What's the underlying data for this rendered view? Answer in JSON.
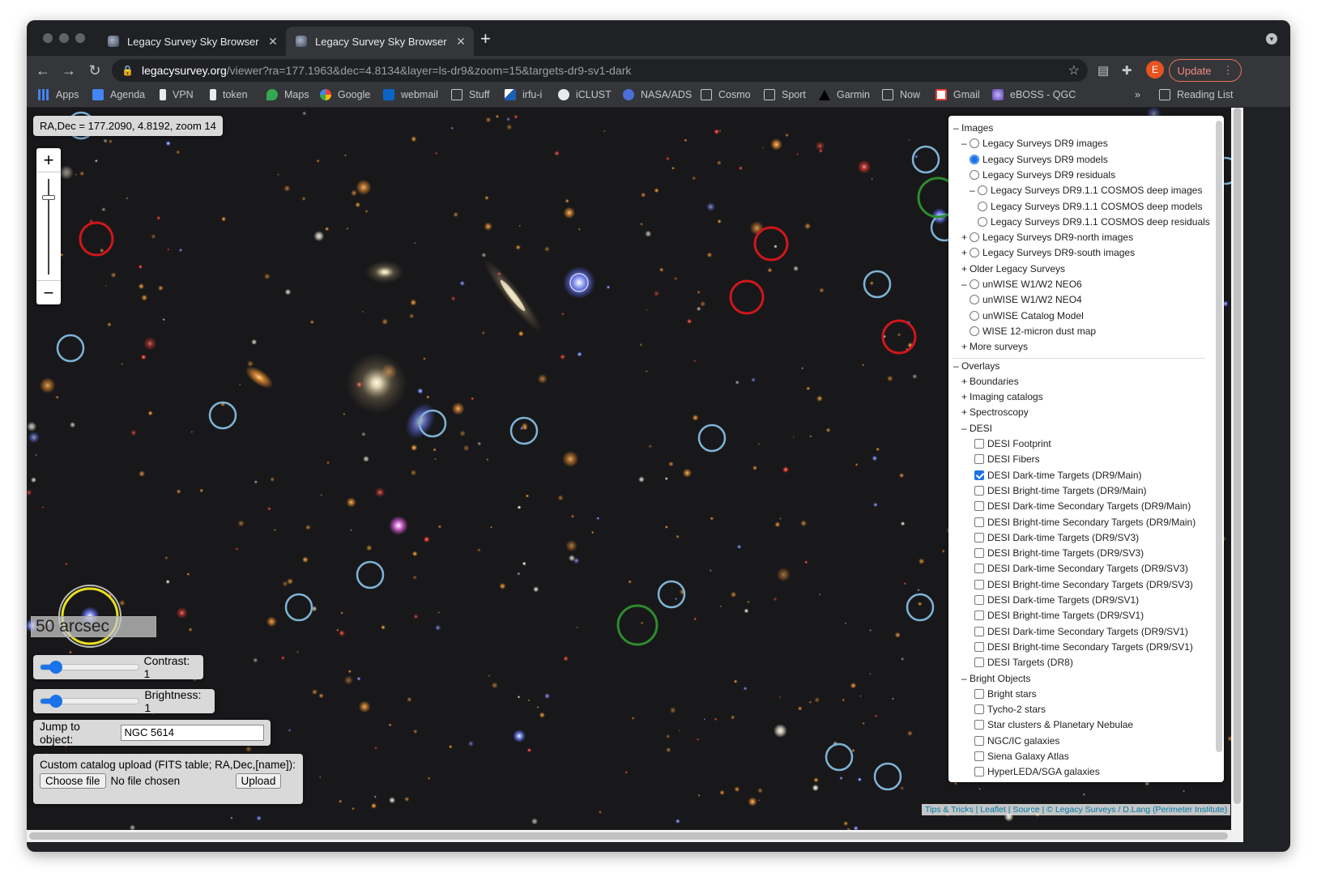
{
  "browser": {
    "tabs": [
      {
        "title": "Legacy Survey Sky Browser",
        "active": false
      },
      {
        "title": "Legacy Survey Sky Browser",
        "active": true
      }
    ],
    "url_host": "legacysurvey.org",
    "url_path": "/viewer?ra=177.1963&dec=4.8134&layer=ls-dr9&zoom=15&targets-dr9-sv1-dark",
    "profile_initial": "E",
    "update_label": "Update",
    "bookmarks": [
      "Apps",
      "Agenda",
      "VPN",
      "token",
      "Maps",
      "Google",
      "webmail",
      "Stuff",
      "irfu-i",
      "iCLUST",
      "NASA/ADS",
      "Cosmo",
      "Sport",
      "Garmin",
      "Now",
      "Gmail",
      "eBOSS - QGC"
    ],
    "more_bookmarks": "»",
    "reading_list": "Reading List"
  },
  "viewer": {
    "coords_text": "RA,Dec = 177.2090, 4.8192, zoom 14",
    "zoom_in": "+",
    "zoom_out": "−",
    "scale_label": "50 arcsec",
    "contrast_label": "Contrast: 1",
    "contrast_value": 0.15,
    "brightness_label": "Brightness: 1",
    "brightness_value": 0.15,
    "jump_label": "Jump to object:",
    "jump_value": "NGC 5614",
    "upload_label": "Custom catalog upload (FITS table; RA,Dec,[name]):",
    "choose_file": "Choose file",
    "no_file": "No file chosen",
    "upload_button": "Upload",
    "attribution": "Tips & Tricks | Leaflet | Source | © Legacy Surveys / D.Lang (Perimeter Institute)"
  },
  "layers": {
    "images_header": "– Images",
    "images": [
      {
        "prefix": "–",
        "label": "Legacy Surveys DR9 images",
        "type": "radio",
        "checked": false,
        "indent": 1
      },
      {
        "prefix": "",
        "label": "Legacy Surveys DR9 models",
        "type": "radio",
        "checked": true,
        "indent": 1
      },
      {
        "prefix": "",
        "label": "Legacy Surveys DR9 residuals",
        "type": "radio",
        "checked": false,
        "indent": 1
      },
      {
        "prefix": "–",
        "label": "Legacy Surveys DR9.1.1 COSMOS deep images",
        "type": "radio",
        "checked": false,
        "indent": 2
      },
      {
        "prefix": "",
        "label": "Legacy Surveys DR9.1.1 COSMOS deep models",
        "type": "radio",
        "checked": false,
        "indent": 2
      },
      {
        "prefix": "",
        "label": "Legacy Surveys DR9.1.1 COSMOS deep residuals",
        "type": "radio",
        "checked": false,
        "indent": 2
      },
      {
        "prefix": "+",
        "label": "Legacy Surveys DR9-north images",
        "type": "radio",
        "checked": false,
        "indent": 1
      },
      {
        "prefix": "+",
        "label": "Legacy Surveys DR9-south images",
        "type": "radio",
        "checked": false,
        "indent": 1
      },
      {
        "prefix": "+",
        "label": "Older Legacy Surveys",
        "type": "none",
        "checked": false,
        "indent": 1
      },
      {
        "prefix": "–",
        "label": "unWISE W1/W2 NEO6",
        "type": "radio",
        "checked": false,
        "indent": 1
      },
      {
        "prefix": "",
        "label": "unWISE W1/W2 NEO4",
        "type": "radio",
        "checked": false,
        "indent": 1
      },
      {
        "prefix": "",
        "label": "unWISE Catalog Model",
        "type": "radio",
        "checked": false,
        "indent": 1
      },
      {
        "prefix": "",
        "label": "WISE 12-micron dust map",
        "type": "radio",
        "checked": false,
        "indent": 1
      },
      {
        "prefix": "+",
        "label": "More surveys",
        "type": "none",
        "checked": false,
        "indent": 1
      }
    ],
    "overlays_header": "– Overlays",
    "overlays": [
      {
        "prefix": "+",
        "label": "Boundaries",
        "type": "none",
        "checked": false
      },
      {
        "prefix": "+",
        "label": "Imaging catalogs",
        "type": "none",
        "checked": false
      },
      {
        "prefix": "+",
        "label": "Spectroscopy",
        "type": "none",
        "checked": false
      },
      {
        "prefix": "–",
        "label": "DESI",
        "type": "none",
        "checked": false
      },
      {
        "prefix": "",
        "label": "DESI Footprint",
        "type": "check",
        "checked": false
      },
      {
        "prefix": "",
        "label": "DESI Fibers",
        "type": "check",
        "checked": false
      },
      {
        "prefix": "",
        "label": "DESI Dark-time Targets (DR9/Main)",
        "type": "check",
        "checked": true
      },
      {
        "prefix": "",
        "label": "DESI Bright-time Targets (DR9/Main)",
        "type": "check",
        "checked": false
      },
      {
        "prefix": "",
        "label": "DESI Dark-time Secondary Targets (DR9/Main)",
        "type": "check",
        "checked": false
      },
      {
        "prefix": "",
        "label": "DESI Bright-time Secondary Targets (DR9/Main)",
        "type": "check",
        "checked": false
      },
      {
        "prefix": "",
        "label": "DESI Dark-time Targets (DR9/SV3)",
        "type": "check",
        "checked": false
      },
      {
        "prefix": "",
        "label": "DESI Bright-time Targets (DR9/SV3)",
        "type": "check",
        "checked": false
      },
      {
        "prefix": "",
        "label": "DESI Dark-time Secondary Targets (DR9/SV3)",
        "type": "check",
        "checked": false
      },
      {
        "prefix": "",
        "label": "DESI Bright-time Secondary Targets (DR9/SV3)",
        "type": "check",
        "checked": false
      },
      {
        "prefix": "",
        "label": "DESI Dark-time Targets (DR9/SV1)",
        "type": "check",
        "checked": false
      },
      {
        "prefix": "",
        "label": "DESI Bright-time Targets (DR9/SV1)",
        "type": "check",
        "checked": false
      },
      {
        "prefix": "",
        "label": "DESI Dark-time Secondary Targets (DR9/SV1)",
        "type": "check",
        "checked": false
      },
      {
        "prefix": "",
        "label": "DESI Bright-time Secondary Targets (DR9/SV1)",
        "type": "check",
        "checked": false
      },
      {
        "prefix": "",
        "label": "DESI Targets (DR8)",
        "type": "check",
        "checked": false
      },
      {
        "prefix": "–",
        "label": "Bright Objects",
        "type": "none",
        "checked": false
      },
      {
        "prefix": "",
        "label": "Bright stars",
        "type": "check",
        "checked": false
      },
      {
        "prefix": "",
        "label": "Tycho-2 stars",
        "type": "check",
        "checked": false
      },
      {
        "prefix": "",
        "label": "Star clusters & Planetary Nebulae",
        "type": "check",
        "checked": false
      },
      {
        "prefix": "",
        "label": "NGC/IC galaxies",
        "type": "check",
        "checked": false
      },
      {
        "prefix": "",
        "label": "Siena Galaxy Atlas",
        "type": "check",
        "checked": false
      },
      {
        "prefix": "",
        "label": "HyperLEDA/SGA galaxies",
        "type": "check",
        "checked": false
      }
    ]
  },
  "colors": {
    "target_blue": "#7fb3d5",
    "target_red": "#d0161b",
    "target_green": "#2e8b2e",
    "target_yellow": "#e8e020",
    "accent": "#1a73e8"
  }
}
